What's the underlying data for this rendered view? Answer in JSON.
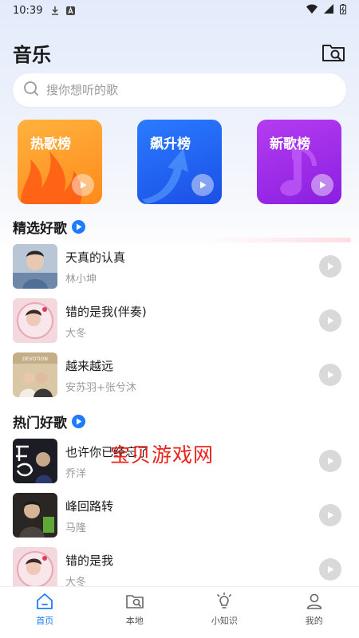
{
  "status_bar": {
    "time": "10:39"
  },
  "header": {
    "title": "音乐"
  },
  "search": {
    "placeholder": "搜你想听的歌"
  },
  "charts": [
    {
      "label": "热歌榜",
      "color": "#ff9a2a"
    },
    {
      "label": "飙升榜",
      "color": "#2563f5"
    },
    {
      "label": "新歌榜",
      "color": "#a12ee8"
    }
  ],
  "sections": {
    "featured": {
      "title": "精选好歌",
      "songs": [
        {
          "title": "天真的认真",
          "artist": "林小坤"
        },
        {
          "title": "错的是我(伴奏)",
          "artist": "大冬"
        },
        {
          "title": "越来越远",
          "artist": "安苏羽+张兮沐"
        }
      ]
    },
    "hot": {
      "title": "热门好歌",
      "songs": [
        {
          "title": "也许你已经忘了",
          "artist": "乔洋"
        },
        {
          "title": "峰回路转",
          "artist": "马隆"
        },
        {
          "title": "错的是我",
          "artist": "大冬"
        }
      ]
    }
  },
  "cover_text": {
    "devotion": "DEVOTION"
  },
  "watermark": "宝贝游戏网",
  "tabs": [
    {
      "label": "首页",
      "icon": "home-icon",
      "active": true
    },
    {
      "label": "本地",
      "icon": "local-folder-icon",
      "active": false
    },
    {
      "label": "小知识",
      "icon": "bulb-icon",
      "active": false
    },
    {
      "label": "我的",
      "icon": "user-icon",
      "active": false
    }
  ],
  "colors": {
    "accent": "#1e7bff",
    "watermark": "#e8231c"
  }
}
